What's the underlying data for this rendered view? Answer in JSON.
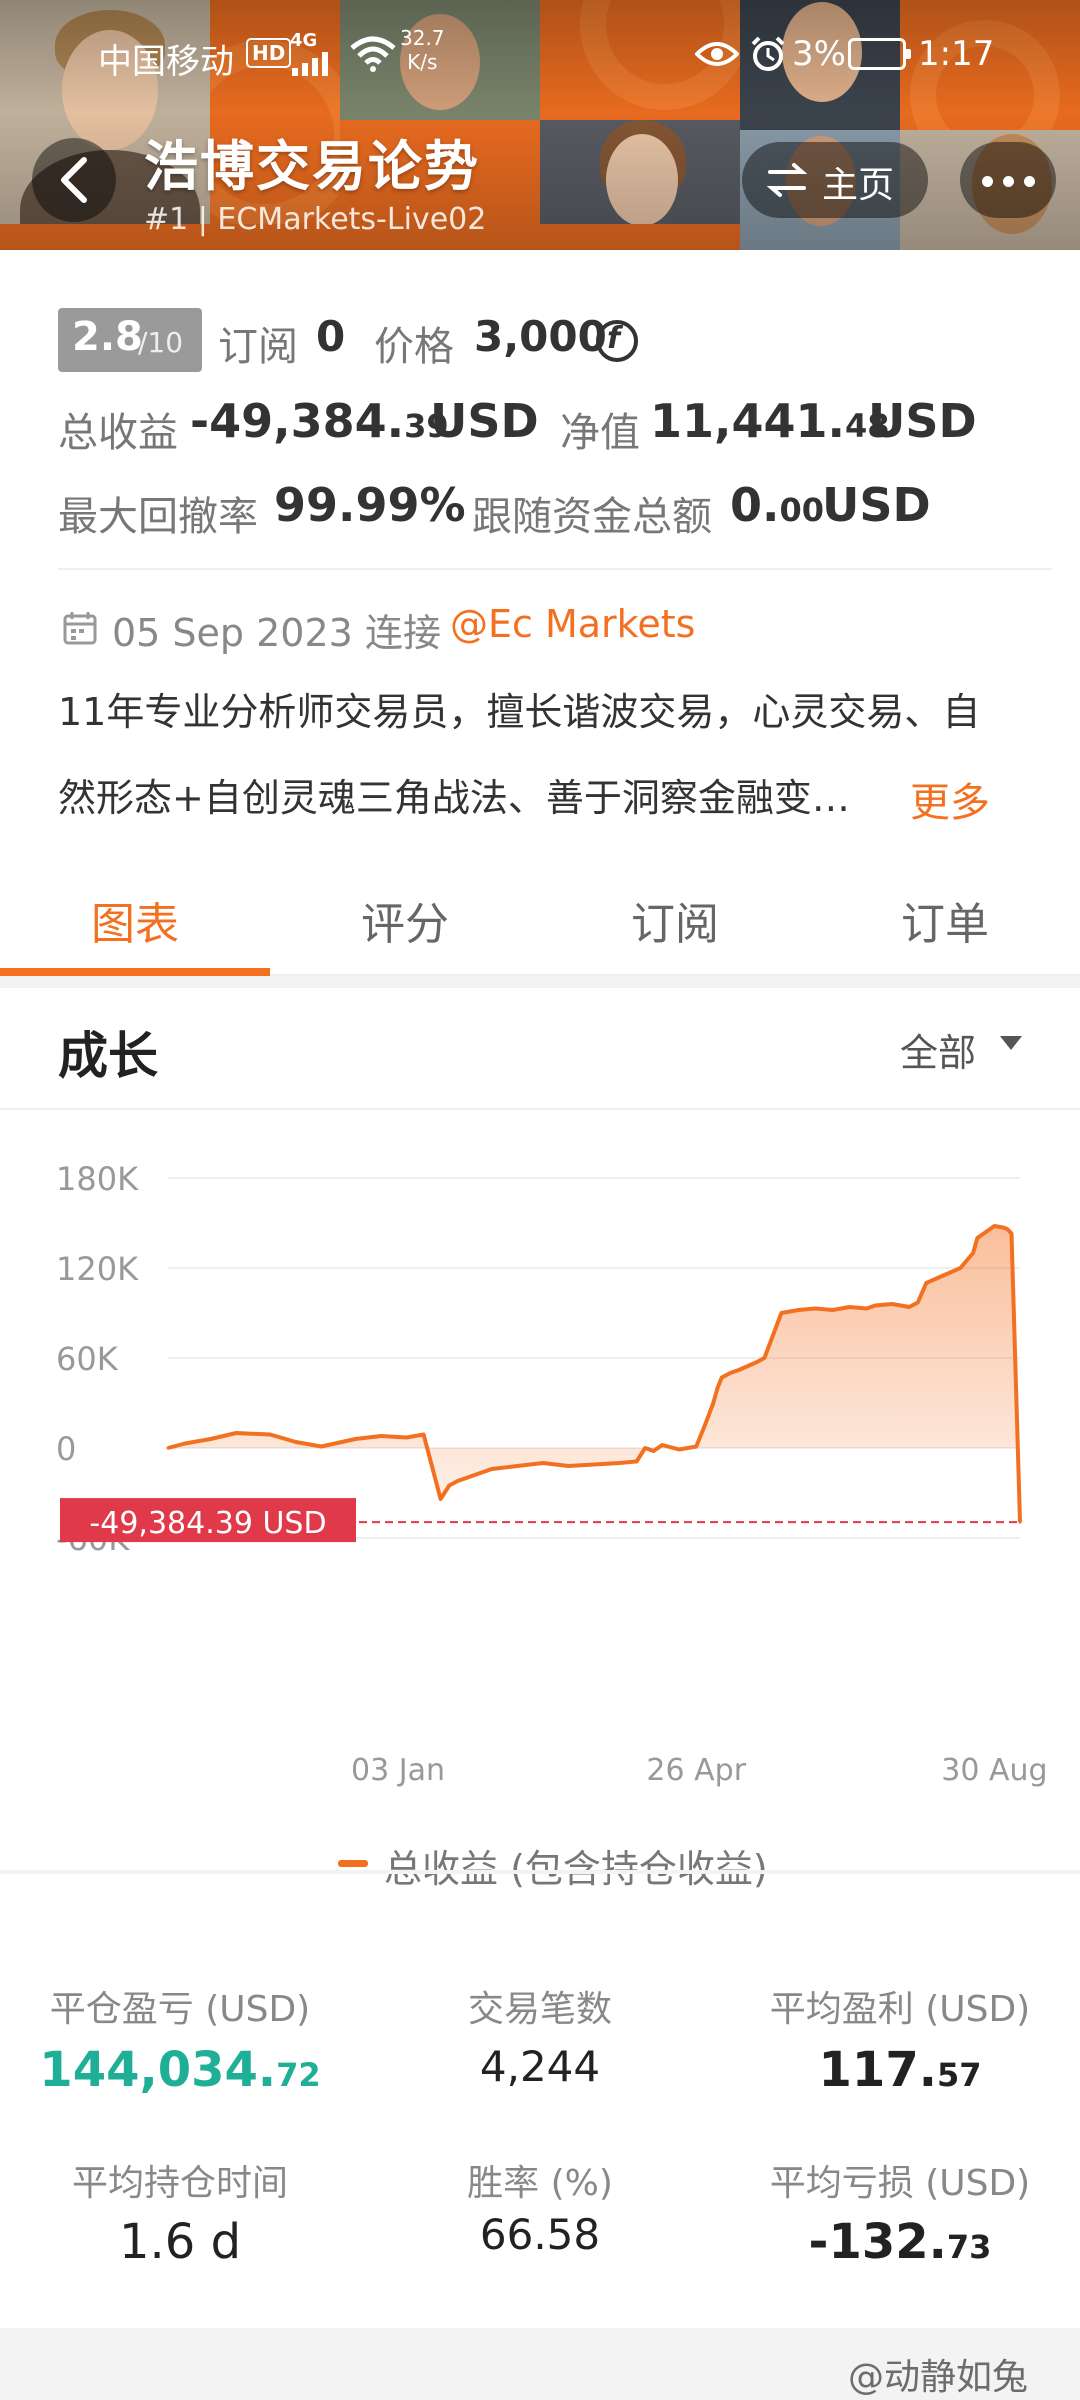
{
  "status_bar": {
    "carrier": "中国移动",
    "hd": "HD",
    "network": "4G",
    "speed_value": "32.7",
    "speed_unit": "K/s",
    "battery": "3%",
    "time": "1:17"
  },
  "header": {
    "title": "浩博交易论势",
    "subtitle": "#1 | ECMarkets-Live02",
    "home_label": "主页"
  },
  "stats": {
    "rating": "2.8",
    "rating_max": "/10",
    "subscribe_label": "订阅",
    "subscribe_count": "0",
    "price_label": "价格",
    "price_value": "3,000",
    "total_profit_label": "总收益",
    "total_profit_main": "-49,384.",
    "total_profit_dec": "39",
    "total_profit_unit": "USD",
    "equity_label": "净值",
    "equity_main": "11,441.",
    "equity_dec": "48",
    "equity_unit": "USD",
    "drawdown_label": "最大回撤率",
    "drawdown_value": "99.99%",
    "follow_label": "跟随资金总额",
    "follow_main": "0.",
    "follow_dec": "00",
    "follow_unit": "USD"
  },
  "connection": {
    "date": "05 Sep 2023",
    "connect_label": "连接",
    "broker": "@Ec Markets"
  },
  "bio": {
    "line1": "11年专业分析师交易员，擅长谐波交易，心灵交易、自",
    "line2": "然形态+自创灵魂三角战法、善于洞察金融变…",
    "more": "更多"
  },
  "tabs": [
    "图表",
    "评分",
    "订阅",
    "订单"
  ],
  "section": {
    "title": "成长",
    "filter": "全部"
  },
  "chart_data": {
    "type": "area",
    "y_ticks": [
      "180K",
      "120K",
      "60K",
      "0",
      "-60K"
    ],
    "ylim": [
      -60000,
      180000
    ],
    "x_ticks": [
      "03 Jan",
      "26 Apr",
      "30 Aug"
    ],
    "last_value_label": "-49,384.39 USD",
    "legend": "总收益 (包含持仓收益)",
    "color": "#f37021",
    "x": [
      0,
      0.02,
      0.05,
      0.08,
      0.12,
      0.15,
      0.18,
      0.22,
      0.25,
      0.28,
      0.3,
      0.32,
      0.33,
      0.34,
      0.36,
      0.38,
      0.41,
      0.44,
      0.47,
      0.5,
      0.53,
      0.55,
      0.56,
      0.57,
      0.58,
      0.6,
      0.62,
      0.63,
      0.64,
      0.645,
      0.65,
      0.66,
      0.67,
      0.69,
      0.7,
      0.71,
      0.72,
      0.74,
      0.76,
      0.78,
      0.8,
      0.82,
      0.83,
      0.85,
      0.87,
      0.88,
      0.89,
      0.91,
      0.93,
      0.945,
      0.95,
      0.96,
      0.97,
      0.98,
      0.985,
      0.99,
      1.0
    ],
    "values": [
      0,
      3000,
      6000,
      10000,
      9000,
      4000,
      1000,
      6000,
      8000,
      7000,
      9000,
      -34000,
      -25000,
      -22000,
      -18000,
      -14000,
      -12000,
      -10000,
      -12000,
      -11000,
      -10000,
      -9000,
      0,
      -2000,
      2000,
      -1000,
      1000,
      15000,
      30000,
      40000,
      47000,
      50000,
      52000,
      57000,
      60000,
      75000,
      90000,
      92000,
      93000,
      92000,
      94000,
      93000,
      95000,
      96000,
      94000,
      97000,
      110000,
      115000,
      120000,
      130000,
      140000,
      144000,
      148000,
      147000,
      146000,
      143000,
      -49384.39
    ]
  },
  "summary": [
    {
      "label": "平仓盈亏 (USD)",
      "main": "144,034.",
      "dec": "72",
      "color": "green"
    },
    {
      "label": "交易笔数",
      "main": "4,244",
      "dec": "",
      "color": ""
    },
    {
      "label": "平均盈利 (USD)",
      "main": "117.",
      "dec": "57",
      "color": ""
    },
    {
      "label": "平均持仓时间",
      "main": "1.6 d",
      "dec": "",
      "color": ""
    },
    {
      "label": "胜率 (%)",
      "main": "66.58",
      "dec": "",
      "color": ""
    },
    {
      "label": "平均亏损 (USD)",
      "main": "-132.",
      "dec": "73",
      "color": ""
    }
  ],
  "watermark": "@动静如兔"
}
